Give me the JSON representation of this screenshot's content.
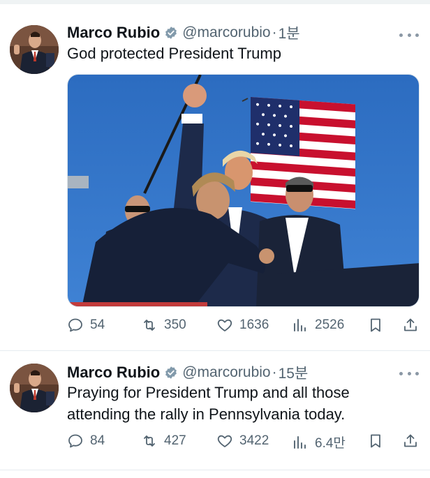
{
  "tweets": [
    {
      "author_name": "Marco Rubio",
      "handle": "@marcorubio",
      "separator": "·",
      "time": "1분",
      "text_lines": [
        "God protected President Trump"
      ],
      "media_description_icon": "photo",
      "counts": {
        "replies": "54",
        "retweets": "350",
        "likes": "1636",
        "views": "2526"
      }
    },
    {
      "author_name": "Marco Rubio",
      "handle": "@marcorubio",
      "separator": "·",
      "time": "15분",
      "text_lines": [
        "Praying for President Trump and all those",
        "attending the rally in Pennsylvania today."
      ],
      "counts": {
        "replies": "84",
        "retweets": "427",
        "likes": "3422",
        "views": "6.4만"
      }
    }
  ],
  "icons": [
    "verified-badge-icon",
    "more-icon",
    "reply-icon",
    "retweet-icon",
    "like-icon",
    "views-icon",
    "bookmark-icon",
    "share-icon"
  ],
  "colors": {
    "text": "#0f1419",
    "secondary": "#536471",
    "verified_blue": "#1d9bf0",
    "sky": "#2f6fc2"
  }
}
